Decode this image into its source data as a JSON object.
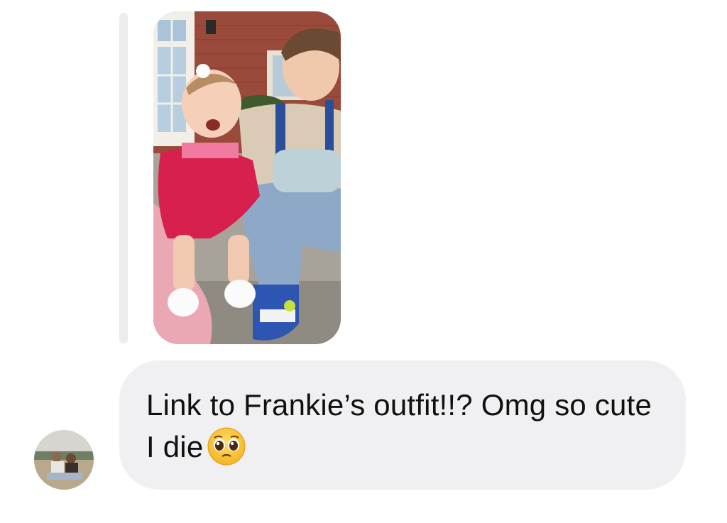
{
  "reply": {
    "photo_icon": "shared-photo-thumbnail"
  },
  "message": {
    "text": "Link to Frankie’s outfit!!? Omg so cute I die",
    "emoji": "pleading-face-emoji",
    "emoji_char": "🥺"
  },
  "sender": {
    "avatar_icon": "profile-photo-avatar"
  },
  "colors": {
    "bubble_bg": "#f0f0f2",
    "reply_bar": "#ececee",
    "text": "#101010"
  }
}
